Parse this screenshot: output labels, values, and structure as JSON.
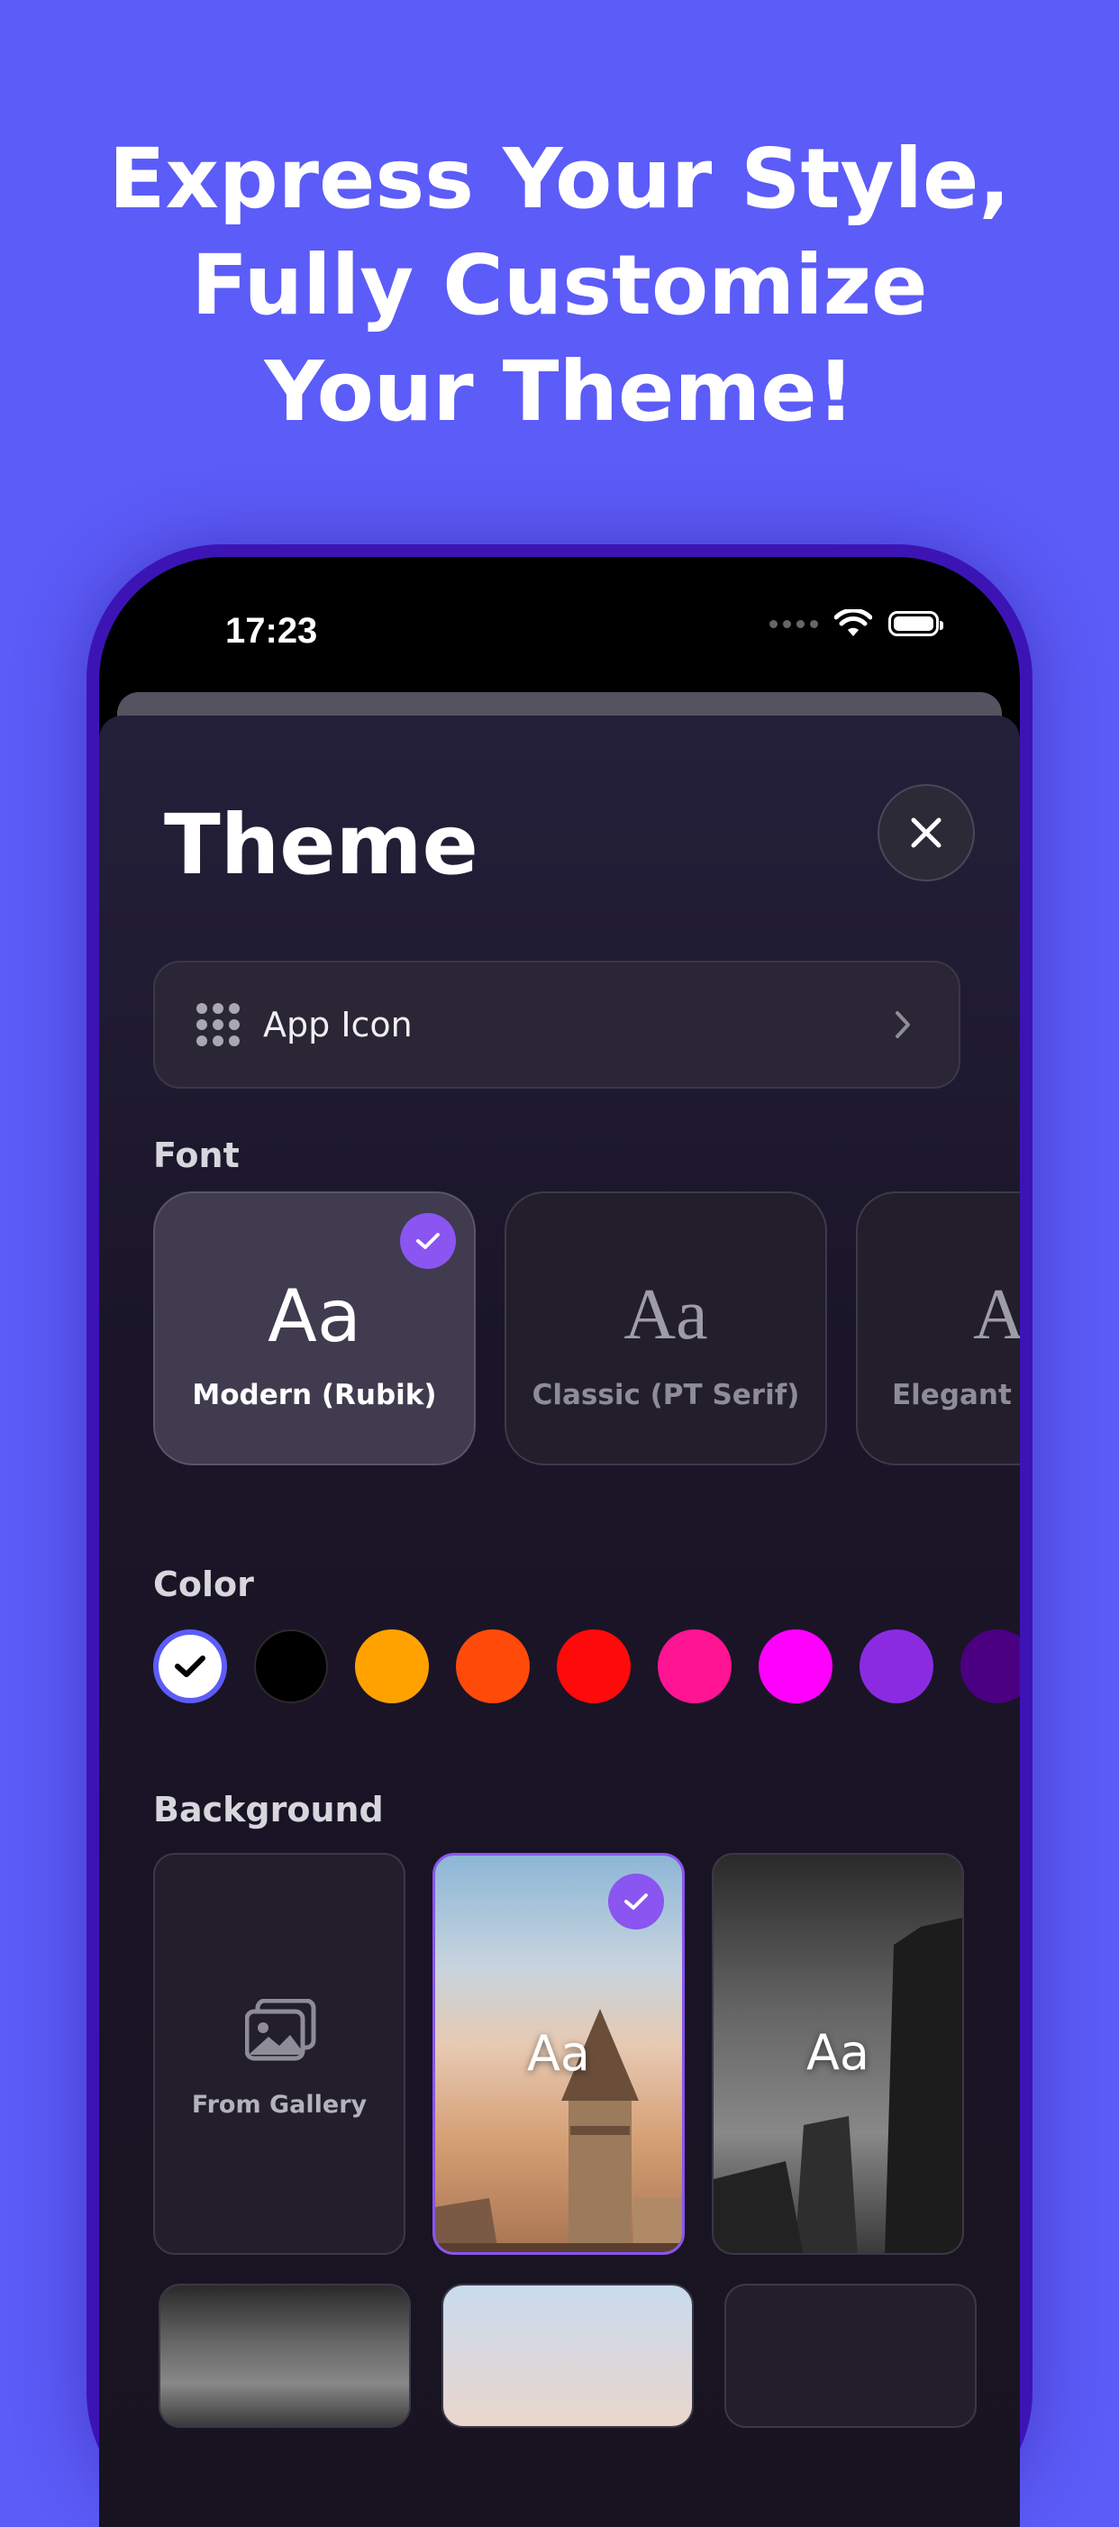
{
  "headline": [
    "Express Your Style,",
    "Fully Customize",
    "Your Theme!"
  ],
  "status_bar": {
    "time": "17:23"
  },
  "sheet": {
    "title": "Theme",
    "app_icon_label": "App Icon",
    "font_section": "Font",
    "fonts": [
      {
        "sample": "Aa",
        "name": "Modern (Rubik)",
        "selected": true
      },
      {
        "sample": "Aa",
        "name": "Classic (PT Serif)",
        "selected": false
      },
      {
        "sample": "A",
        "name": "Elegant (",
        "selected": false
      }
    ],
    "color_section": "Color",
    "colors": [
      "#ffffff",
      "#000000",
      "#ffa200",
      "#ff4a0a",
      "#ff0a0a",
      "#ff1493",
      "#ff00ff",
      "#8a2be2",
      "#4b0082"
    ],
    "selected_color": "#ffffff",
    "background_section": "Background",
    "backgrounds": [
      {
        "type": "gallery",
        "label": "From Gallery"
      },
      {
        "type": "photo",
        "sample": "Aa",
        "selected": true
      },
      {
        "type": "photo",
        "sample": "Aa",
        "selected": false
      }
    ],
    "accent": "#8a55f0"
  }
}
